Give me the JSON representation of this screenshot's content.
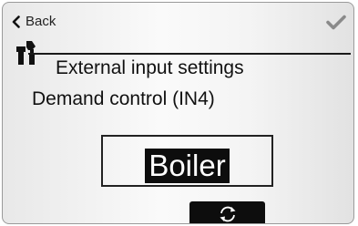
{
  "nav": {
    "back_label": "Back",
    "back_icon": "chevron-left-icon",
    "confirm_icon": "checkmark-icon"
  },
  "header": {
    "section_icon": "tools-icon",
    "title": "External input settings",
    "subtitle": "Demand control (IN4)"
  },
  "setting": {
    "value": "Boiler",
    "cycle_icon": "refresh-cycle-icon"
  },
  "colors": {
    "highlight_bg": "#0d0d0d",
    "highlight_text": "#ffffff",
    "confirm_check": "#8a8a8a"
  }
}
